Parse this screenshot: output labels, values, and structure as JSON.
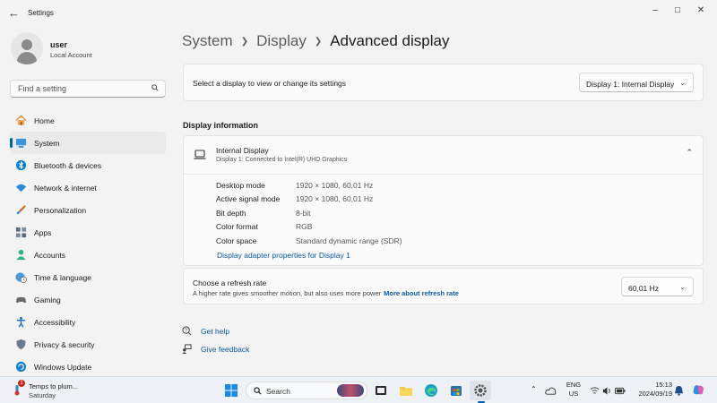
{
  "window": {
    "title": "Settings"
  },
  "profile": {
    "name": "user",
    "account": "Local Account"
  },
  "search": {
    "placeholder": "Find a setting"
  },
  "nav": [
    {
      "label": "Home",
      "icon": "home-icon"
    },
    {
      "label": "System",
      "icon": "system-icon",
      "active": true
    },
    {
      "label": "Bluetooth & devices",
      "icon": "bluetooth-icon"
    },
    {
      "label": "Network & internet",
      "icon": "wifi-icon"
    },
    {
      "label": "Personalization",
      "icon": "brush-icon"
    },
    {
      "label": "Apps",
      "icon": "apps-icon"
    },
    {
      "label": "Accounts",
      "icon": "person-icon"
    },
    {
      "label": "Time & language",
      "icon": "globe-clock-icon"
    },
    {
      "label": "Gaming",
      "icon": "gamepad-icon"
    },
    {
      "label": "Accessibility",
      "icon": "accessibility-icon"
    },
    {
      "label": "Privacy & security",
      "icon": "shield-icon"
    },
    {
      "label": "Windows Update",
      "icon": "update-icon"
    }
  ],
  "breadcrumb": {
    "system": "System",
    "display": "Display",
    "current": "Advanced display"
  },
  "select_display": {
    "label": "Select a display to view or change its settings",
    "value": "Display 1: Internal Display"
  },
  "display_info": {
    "section_title": "Display information",
    "name": "Internal Display",
    "subtitle": "Display 1: Connected to Intel(R) UHD Graphics",
    "rows": [
      {
        "label": "Desktop mode",
        "value": "1920 × 1080, 60,01 Hz"
      },
      {
        "label": "Active signal mode",
        "value": "1920 × 1080, 60,01 Hz"
      },
      {
        "label": "Bit depth",
        "value": "8-bit"
      },
      {
        "label": "Color format",
        "value": "RGB"
      },
      {
        "label": "Color space",
        "value": "Standard dynamic range (SDR)"
      }
    ],
    "adapter_link": "Display adapter properties for Display 1"
  },
  "refresh_rate": {
    "title": "Choose a refresh rate",
    "description": "A higher rate gives smoother motion, but also uses more power",
    "more_link": "More about refresh rate",
    "value": "60,01 Hz"
  },
  "help": {
    "get_help": "Get help",
    "give_feedback": "Give feedback"
  },
  "taskbar": {
    "weather_title": "Temps to plum...",
    "weather_day": "Saturday",
    "weather_badge": "1",
    "search_label": "Search",
    "lang_top": "ENG",
    "lang_bottom": "US",
    "time": "15:13",
    "date": "2024/09/19"
  },
  "colors": {
    "accent": "#005fb8",
    "link": "#0b57a4"
  }
}
